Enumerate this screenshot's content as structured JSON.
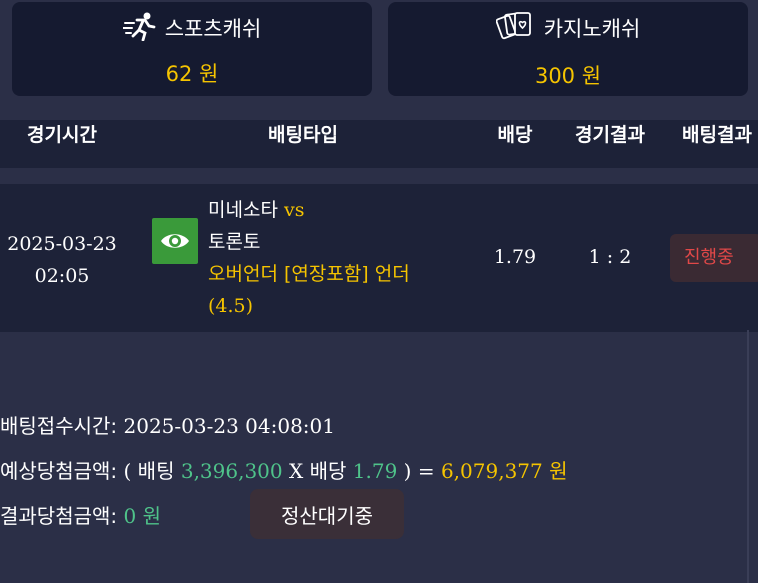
{
  "cash": {
    "sports": {
      "label": "스포츠캐쉬",
      "amount": "62 원",
      "icon": "running-person-icon"
    },
    "casino": {
      "label": "카지노캐쉬",
      "amount": "300 원",
      "icon": "playing-cards-icon"
    }
  },
  "table": {
    "headers": [
      "경기시간",
      "배팅타입",
      "배당",
      "경기결과",
      "배팅결과"
    ]
  },
  "bet": {
    "date": "2025-03-23",
    "time": "02:05",
    "icon": "eye-icon",
    "home": "미네소타",
    "vs": "vs",
    "away": "토론토",
    "pick_line1": "오버언더 [연장포함] 언더",
    "pick_line2": "(4.5)",
    "odds": "1.79",
    "score": "1 : 2",
    "status": "진행중"
  },
  "summary": {
    "received_label": "배팅접수시간:",
    "received_value": "2025-03-23 04:08:01",
    "expected_label": "예상당첨금액:",
    "open_paren": "(",
    "bet_label": "배팅",
    "bet_amount": "3,396,300",
    "times": "X",
    "odds_label": "배당",
    "odds_value": "1.79",
    "close_eq": ") =",
    "payout": "6,079,377 원",
    "result_label": "결과당첨금액:",
    "result_value": "0 원",
    "settle_button": "정산대기중"
  },
  "colors": {
    "background": "#2b2f47",
    "panel": "#1d2238",
    "card": "#151a30",
    "accent_yellow": "#f5c400",
    "accent_green": "#4fc38a",
    "status_red": "#e04848"
  }
}
